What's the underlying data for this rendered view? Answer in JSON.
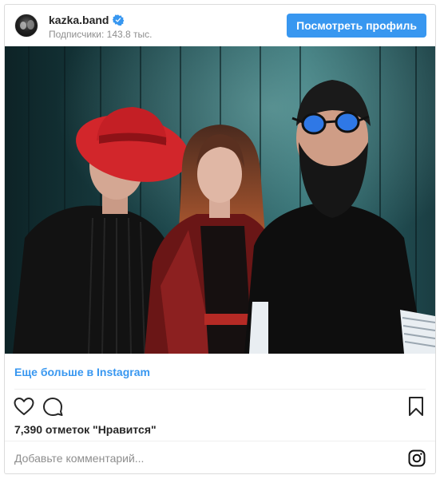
{
  "header": {
    "username": "kazka.band",
    "followers_text": "Подписчики: 143.8 тыс.",
    "view_profile_label": "Посмотреть профиль",
    "verified_icon": "verified-badge-icon"
  },
  "footer": {
    "more_link": "Еще больше в Instagram",
    "likes_text": "7,390 отметок \"Нравится\"",
    "comment_placeholder": "Добавьте комментарий..."
  },
  "icons": {
    "like": "heart-icon",
    "comment": "comment-bubble-icon",
    "save": "bookmark-icon",
    "brand": "instagram-logo-icon"
  },
  "colors": {
    "accent": "#3897f0",
    "text": "#262626",
    "muted": "#8e8e8e",
    "border": "#dbdbdb"
  }
}
